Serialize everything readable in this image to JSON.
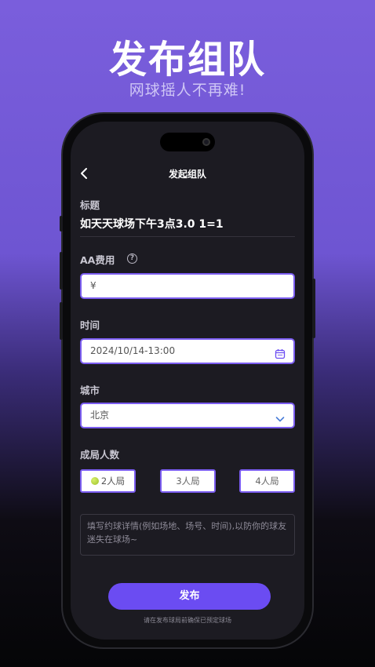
{
  "hero": {
    "title": "发布组队",
    "subtitle": "网球摇人不再难!"
  },
  "nav": {
    "title": "发起组队",
    "back_icon": "chevron-left-icon"
  },
  "form": {
    "title_label": "标题",
    "title_value": "如天天球场下午3点3.0 1=1",
    "fee_label": "AA费用",
    "fee_value": "¥",
    "time_label": "时间",
    "time_value": "2024/10/14-13:00",
    "city_label": "城市",
    "city_value": "北京",
    "players_label": "成局人数",
    "players_options": [
      "2人局",
      "3人局",
      "4人局"
    ],
    "players_selected": "2人局",
    "details_placeholder": "填写约球详情(例如场地、场号、时间),以防你的球友迷失在球场~"
  },
  "actions": {
    "publish_label": "发布",
    "footnote": "请在发布球局前确保已预定球场"
  },
  "colors": {
    "accent": "#6b4cf2",
    "field_border": "#7b5df0",
    "screen_bg": "#1c1b22"
  }
}
